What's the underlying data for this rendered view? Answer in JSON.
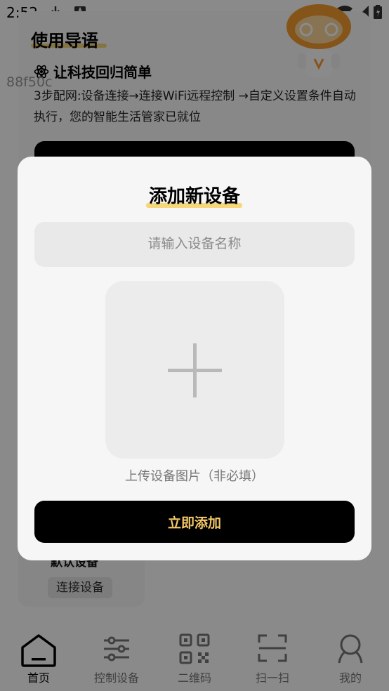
{
  "status_bar": {
    "time": "2:52"
  },
  "guide": {
    "title": "使用导语",
    "subtitle": "让科技回归简单",
    "code": "88f50c",
    "description": "3步配网:设备连接→连接WiFi远程控制 →自定义设置条件自动执行，您的智能生活管家已就位"
  },
  "device": {
    "name": "默认设备",
    "connect_label": "连接设备"
  },
  "bottom_nav": {
    "items": [
      {
        "label": "首页"
      },
      {
        "label": "控制设备"
      },
      {
        "label": "二维码"
      },
      {
        "label": "扫一扫"
      },
      {
        "label": "我的"
      }
    ]
  },
  "dialog": {
    "title": "添加新设备",
    "name_placeholder": "请输入设备名称",
    "name_value": "",
    "upload_label": "上传设备图片（非必填）",
    "submit_label": "立即添加"
  },
  "colors": {
    "accent": "#f6d77a",
    "button_text": "#f4c968"
  }
}
